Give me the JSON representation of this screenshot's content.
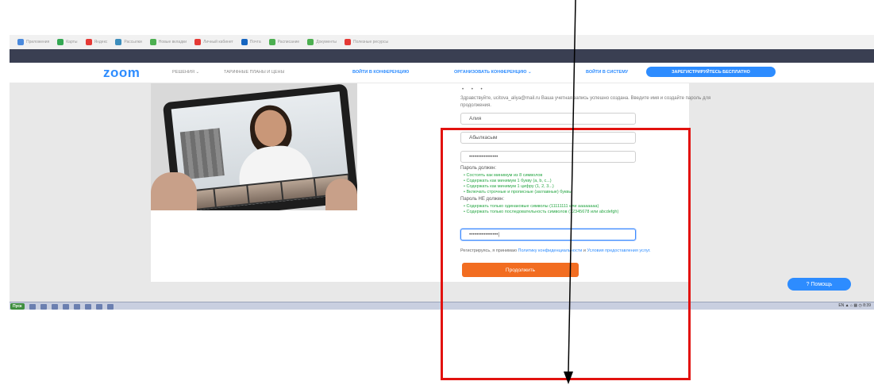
{
  "bookmarks": [
    {
      "label": "Приложения",
      "color": "#4a89dc"
    },
    {
      "label": "Карты",
      "color": "#34a853"
    },
    {
      "label": "Яндекс",
      "color": "#e53935"
    },
    {
      "label": "Рассылки",
      "color": "#3c8dbc"
    },
    {
      "label": "Новые вкладки",
      "color": "#4caf50"
    },
    {
      "label": "Личный кабинет",
      "color": "#e53935"
    },
    {
      "label": "Почта",
      "color": "#1565c0"
    },
    {
      "label": "Расписание",
      "color": "#4caf50"
    },
    {
      "label": "Документы",
      "color": "#4caf50"
    },
    {
      "label": "Полезные ресурсы",
      "color": "#e53935"
    }
  ],
  "nav": {
    "logo": "zoom",
    "solutions": "РЕШЕНИЯ ⌄",
    "plans": "ТАРИФНЫЕ ПЛАНЫ И ЦЕНЫ",
    "join": "ВОЙТИ В КОНФЕРЕНЦИЮ",
    "host": "ОРГАНИЗОВАТЬ КОНФЕРЕНЦИЮ ⌄",
    "signin": "ВОЙТИ В СИСТЕМУ",
    "signup": "ЗАРЕГИСТРИРУЙТЕСЬ БЕСПЛАТНО"
  },
  "form": {
    "dots": "• • •",
    "intro": "Здравствуйте, ucitova_aliya@mail.ru Ваша учетная запись успешно создана. Введите имя и создайте пароль для продолжения.",
    "first_name": "Алия",
    "last_name": "Абылкасым",
    "password": "••••••••••••••••",
    "confirm_password": "••••••••••••••••|",
    "must_label": "Пароль должен:",
    "must_rules": [
      "Состоять как минимум из 8 символов",
      "Содержать как минимум 1 букву (a, b, c...)",
      "Содержать как минимум 1 цифру (1, 2, 3...)",
      "Включать строчные и прописные (заглавные) буквы"
    ],
    "must_not_label": "Пароль НЕ должен:",
    "must_not_rules": [
      "Содержать только одинаковые символы (11111111 или aaaaaaaa)",
      "Содержать только последовательность символов (12345678 или abcdefgh)"
    ],
    "agree_prefix": "Регистрируясь, я принимаю ",
    "agree_privacy": "Политику конфиденциальности",
    "agree_and": " и ",
    "agree_terms": "Условия предоставления услуг.",
    "submit": "Продолжить"
  },
  "help": "? Помощь",
  "taskbar": {
    "start": "Пуск",
    "tray": "EN  ▲  ⌂  ▦  ◷  8:39"
  },
  "colors": {
    "annotation_red": "#e2120f",
    "zoom_blue": "#2d8cff",
    "submit_orange": "#f26d21"
  }
}
